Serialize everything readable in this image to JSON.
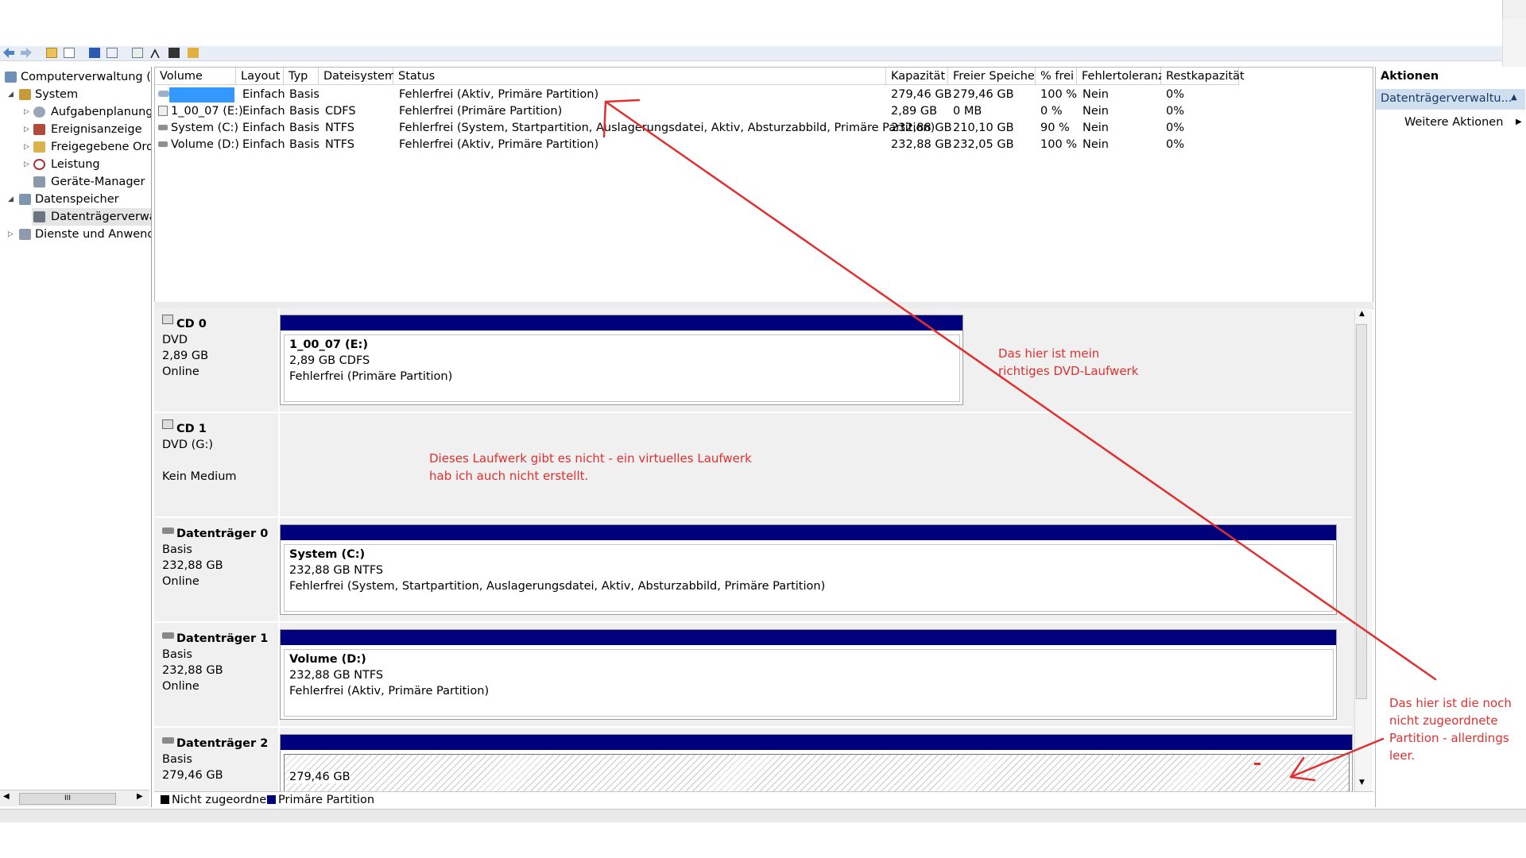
{
  "tree": {
    "items": [
      {
        "label": "Computerverwaltung (Lo"
      },
      {
        "label": "System"
      },
      {
        "label": "Aufgabenplanung"
      },
      {
        "label": "Ereignisanzeige"
      },
      {
        "label": "Freigegebene Ordn"
      },
      {
        "label": "Leistung"
      },
      {
        "label": "Geräte-Manager"
      },
      {
        "label": "Datenspeicher"
      },
      {
        "label": "Datenträgerverwal"
      },
      {
        "label": "Dienste und Anwendu"
      }
    ],
    "scroll_glyph": "III"
  },
  "volume_list": {
    "columns": [
      "Volume",
      "Layout",
      "Typ",
      "Dateisystem",
      "Status",
      "Kapazität",
      "Freier Speicher",
      "% frei",
      "Fehlertoleranz",
      "Restkapazität"
    ],
    "rows": [
      {
        "volume": "",
        "layout": "Einfach",
        "typ": "Basis",
        "fs": "",
        "status": "Fehlerfrei (Aktiv, Primäre Partition)",
        "cap": "279,46 GB",
        "free": "279,46 GB",
        "pct": "100 %",
        "fault": "Nein",
        "rest": "0%"
      },
      {
        "volume": "1_00_07 (E:)",
        "layout": "Einfach",
        "typ": "Basis",
        "fs": "CDFS",
        "status": "Fehlerfrei (Primäre Partition)",
        "cap": "2,89 GB",
        "free": "0 MB",
        "pct": "0 %",
        "fault": "Nein",
        "rest": "0%"
      },
      {
        "volume": "System (C:)",
        "layout": "Einfach",
        "typ": "Basis",
        "fs": "NTFS",
        "status": "Fehlerfrei (System, Startpartition, Auslagerungsdatei, Aktiv, Absturzabbild, Primäre Partition)",
        "cap": "232,88 GB",
        "free": "210,10 GB",
        "pct": "90 %",
        "fault": "Nein",
        "rest": "0%"
      },
      {
        "volume": "Volume (D:)",
        "layout": "Einfach",
        "typ": "Basis",
        "fs": "NTFS",
        "status": "Fehlerfrei (Aktiv, Primäre Partition)",
        "cap": "232,88 GB",
        "free": "232,05 GB",
        "pct": "100 %",
        "fault": "Nein",
        "rest": "0%"
      }
    ]
  },
  "disks": [
    {
      "name": "CD 0",
      "l1": "DVD",
      "l2": "2,89 GB",
      "l3": "Online",
      "part": {
        "title": "1_00_07  (E:)",
        "size": "2,89 GB CDFS",
        "status": "Fehlerfrei (Primäre Partition)"
      }
    },
    {
      "name": "CD 1",
      "l1": "DVD (G:)",
      "l2": "",
      "l3": "Kein Medium"
    },
    {
      "name": "Datenträger 0",
      "l1": "Basis",
      "l2": "232,88 GB",
      "l3": "Online",
      "part": {
        "title": "System  (C:)",
        "size": "232,88 GB NTFS",
        "status": "Fehlerfrei (System, Startpartition, Auslagerungsdatei, Aktiv, Absturzabbild, Primäre Partition)"
      }
    },
    {
      "name": "Datenträger 1",
      "l1": "Basis",
      "l2": "232,88 GB",
      "l3": "Online",
      "part": {
        "title": "Volume  (D:)",
        "size": "232,88 GB NTFS",
        "status": "Fehlerfrei (Aktiv, Primäre Partition)"
      }
    },
    {
      "name": "Datenträger 2",
      "l1": "Basis",
      "l2": "279,46 GB",
      "l3": "",
      "part": {
        "title": "",
        "size": "279,46 GB",
        "status": ""
      }
    }
  ],
  "legend": {
    "unallocated": "Nicht zugeordnet",
    "primary": "Primäre Partition"
  },
  "actions": {
    "title": "Aktionen",
    "section": "Datenträgerverwaltu...",
    "more": "Weitere Aktionen"
  },
  "annotations": {
    "dvd": "Das hier ist mein\nrichtiges DVD-Laufwerk",
    "virtual": "Dieses Laufwerk gibt es nicht - ein virtuelles Laufwerk\nhab ich auch nicht erstellt.",
    "partition": "Das hier ist die noch\nnicht zugeordnete\nPartition - allerdings\nleer."
  },
  "colors": {
    "primary_partition": "#00007d",
    "annotation": "#e03030",
    "selection": "#3399ff"
  }
}
